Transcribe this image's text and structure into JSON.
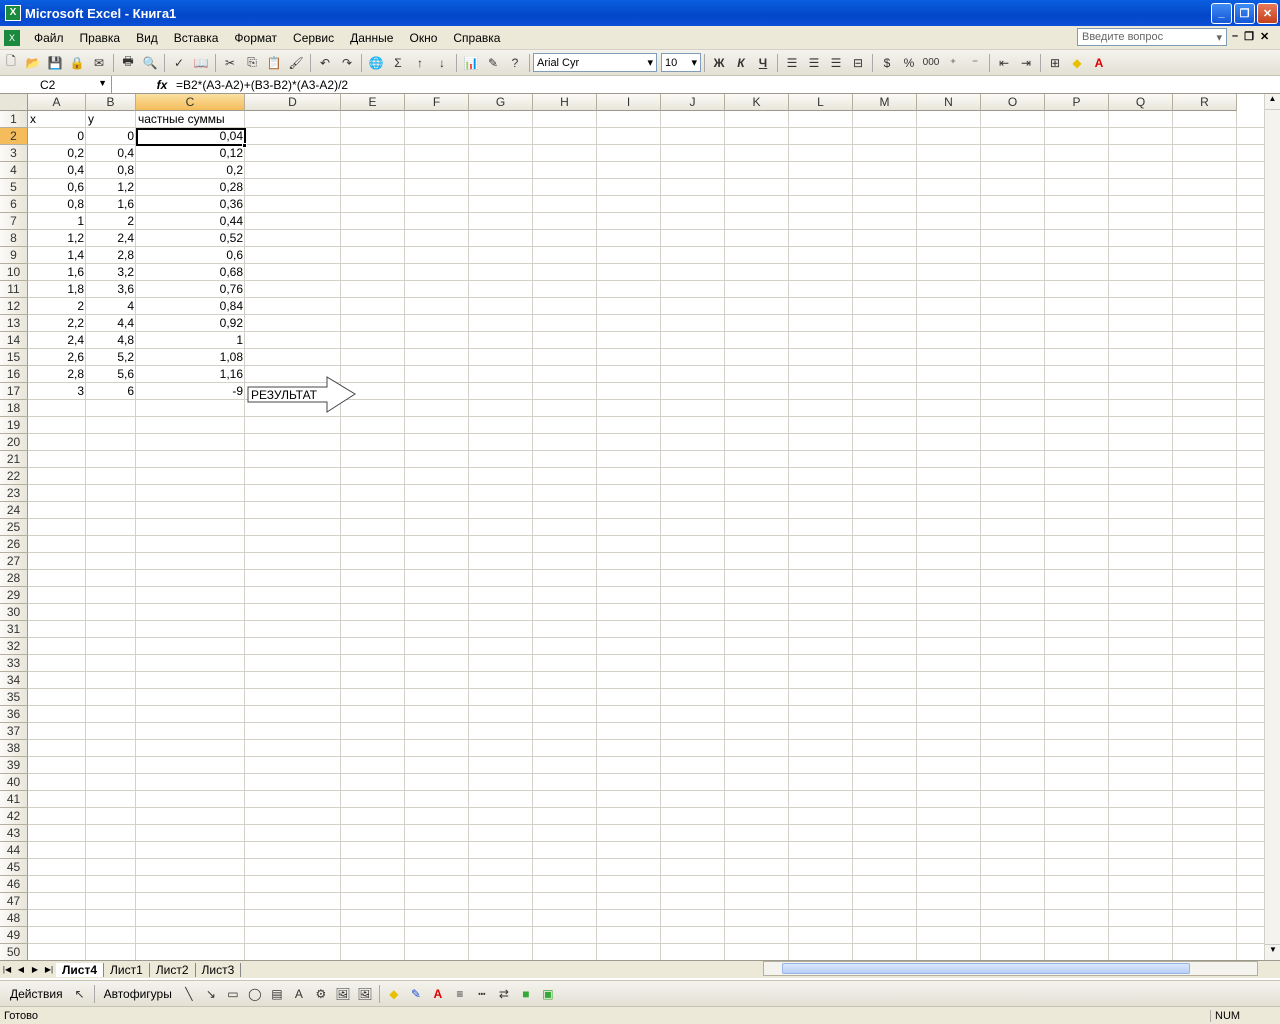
{
  "window": {
    "title": "Microsoft Excel - Книга1",
    "minimize": "_",
    "maximize": "❐",
    "close": "✕"
  },
  "menu": {
    "items": [
      "Файл",
      "Правка",
      "Вид",
      "Вставка",
      "Формат",
      "Сервис",
      "Данные",
      "Окно",
      "Справка"
    ],
    "help_placeholder": "Введите вопрос"
  },
  "toolbar": {
    "font_name": "Arial Cyr",
    "font_size": "10",
    "bold": "Ж",
    "italic": "К",
    "underline": "Ч",
    "percent": "%",
    "thousands": "000"
  },
  "formula_bar": {
    "cell_ref": "C2",
    "fx": "fx",
    "formula": "=B2*(A3-A2)+(B3-B2)*(A3-A2)/2"
  },
  "columns": [
    "A",
    "B",
    "C",
    "D",
    "E",
    "F",
    "G",
    "H",
    "I",
    "J",
    "K",
    "L",
    "M",
    "N",
    "O",
    "P",
    "Q",
    "R"
  ],
  "rows_count": 50,
  "active_cell": {
    "column": "C",
    "row": 2
  },
  "headers": {
    "a": "x",
    "b": "y",
    "c": "частные суммы"
  },
  "table": [
    [
      "0",
      "0",
      "0,04"
    ],
    [
      "0,2",
      "0,4",
      "0,12"
    ],
    [
      "0,4",
      "0,8",
      "0,2"
    ],
    [
      "0,6",
      "1,2",
      "0,28"
    ],
    [
      "0,8",
      "1,6",
      "0,36"
    ],
    [
      "1",
      "2",
      "0,44"
    ],
    [
      "1,2",
      "2,4",
      "0,52"
    ],
    [
      "1,4",
      "2,8",
      "0,6"
    ],
    [
      "1,6",
      "3,2",
      "0,68"
    ],
    [
      "1,8",
      "3,6",
      "0,76"
    ],
    [
      "2",
      "4",
      "0,84"
    ],
    [
      "2,2",
      "4,4",
      "0,92"
    ],
    [
      "2,4",
      "4,8",
      "1"
    ],
    [
      "2,6",
      "5,2",
      "1,08"
    ],
    [
      "2,8",
      "5,6",
      "1,16"
    ],
    [
      "3",
      "6",
      "-9"
    ]
  ],
  "shape_label": "РЕЗУЛЬТАТ",
  "sheet_tabs": [
    "Лист4",
    "Лист1",
    "Лист2",
    "Лист3"
  ],
  "active_tab": "Лист4",
  "drawing_toolbar": {
    "actions": "Действия",
    "autoshapes": "Автофигуры"
  },
  "status": {
    "ready": "Готово",
    "num": "NUM"
  }
}
